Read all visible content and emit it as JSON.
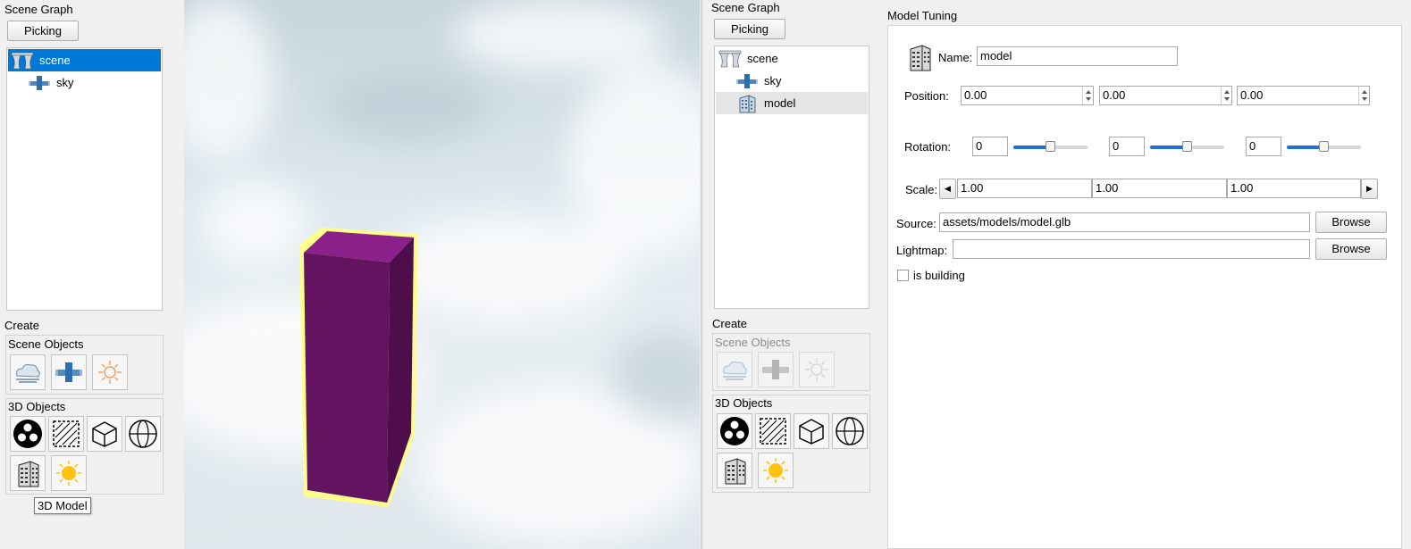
{
  "left_panel": {
    "scene_graph_title": "Scene Graph",
    "picking_label": "Picking",
    "tree": [
      {
        "label": "scene",
        "icon": "curtain-icon",
        "selected": true
      },
      {
        "label": "sky",
        "icon": "sky-icon"
      }
    ],
    "create_title": "Create",
    "scene_objects_title": "Scene Objects",
    "scene_objects": [
      {
        "icon": "sky-tile-icon"
      },
      {
        "icon": "cross-sky-icon"
      },
      {
        "icon": "sun-outline-icon"
      }
    ],
    "objects_3d_title": "3D Objects",
    "objects_3d": [
      {
        "icon": "particles-icon"
      },
      {
        "icon": "plane-icon"
      },
      {
        "icon": "cube-icon"
      },
      {
        "icon": "sphere-icon"
      },
      {
        "icon": "building-icon"
      },
      {
        "icon": "light-icon"
      }
    ],
    "tooltip": "3D Model"
  },
  "viewport": {
    "sky_colors": [
      "#c9d7de",
      "#dde8ee",
      "#e8eef2"
    ],
    "box_front": "#63135f",
    "box_top": "#8a2089",
    "outline": "#fffd8c"
  },
  "right_panel": {
    "scene_graph_title": "Scene Graph",
    "picking_label": "Picking",
    "tree": [
      {
        "label": "scene",
        "icon": "curtain-icon"
      },
      {
        "label": "sky",
        "icon": "sky-icon"
      },
      {
        "label": "model",
        "icon": "building-icon",
        "highlighted": true
      }
    ],
    "create_title": "Create",
    "scene_objects_title": "Scene Objects",
    "objects_3d_title": "3D Objects"
  },
  "tuning": {
    "title": "Model Tuning",
    "name_label": "Name:",
    "name_value": "model",
    "position_label": "Position:",
    "position": [
      "0.00",
      "0.00",
      "0.00"
    ],
    "rotation_label": "Rotation:",
    "rotation": [
      "0",
      "0",
      "0"
    ],
    "rotation_slider_fraction": [
      0.5,
      0.5,
      0.5
    ],
    "scale_label": "Scale:",
    "scale": [
      "1.00",
      "1.00",
      "1.00"
    ],
    "source_label": "Source:",
    "source_value": "assets/models/model.glb",
    "lightmap_label": "Lightmap:",
    "lightmap_value": "",
    "browse_label": "Browse",
    "is_building_label": "is building"
  }
}
